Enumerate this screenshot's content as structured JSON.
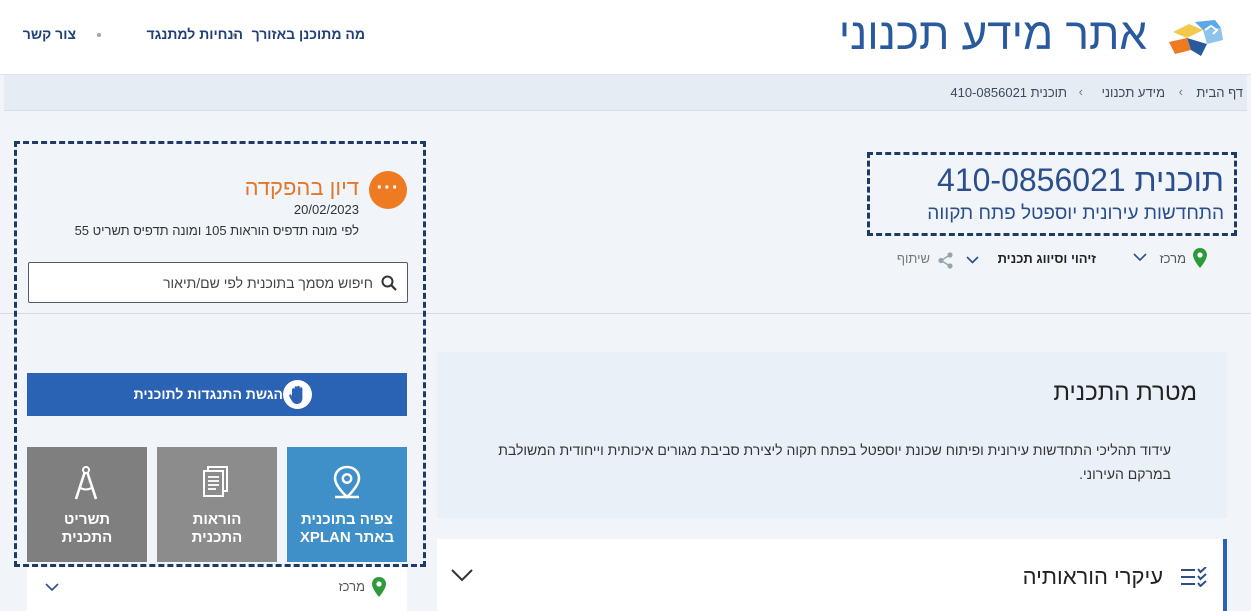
{
  "header": {
    "site_title": "אתר מידע תכנוני",
    "nav": [
      "מה מתוכנן באזורך",
      "הנחיות למתנגד",
      "צור קשר"
    ]
  },
  "breadcrumb": [
    "דף הבית",
    "מידע תכנוני",
    "תוכנית 410-0856021"
  ],
  "plan": {
    "title": "תוכנית 410-0856021",
    "subtitle": "התחדשות עירונית יוספטל פתח תקווה",
    "actions": {
      "center": "מרכז",
      "identification": "זיהוי וסיווג תכנית",
      "share": "שיתוף"
    }
  },
  "status": {
    "title": "דיון בהפקדה",
    "date": "20/02/2023",
    "note": "לפי מונה תדפיס הוראות 105 ומונה תדפיס תשריט 55",
    "circle_icon": "ellipsis-icon"
  },
  "search": {
    "placeholder": "חיפוש מסמך בתוכנית לפי שם/תיאור",
    "value": ""
  },
  "objection_button": "הגשת התנגדות לתוכנית",
  "tiles": [
    {
      "label": "צפיה בתוכנית\nבאתר XPLAN",
      "color": "#3f8fc8",
      "icon": "location-pin-icon"
    },
    {
      "label": "הוראות\nהתכנית",
      "color": "#8c8c8c",
      "icon": "document-icon"
    },
    {
      "label": "תשריט\nהתכנית",
      "color": "#7f7f7f",
      "icon": "compass-icon"
    }
  ],
  "lower_card": {
    "center": "מרכז"
  },
  "goal": {
    "title": "מטרת התכנית",
    "text": "עידוד תהליכי התחדשות עירונית ופיתוח שכונת יוספטל בפתח תקוה ליצירת סביבת מגורים איכותית וייחודית המשולבת במרקם העירוני."
  },
  "provisions": {
    "title": "עיקרי הוראותיה"
  },
  "colors": {
    "primary_blue": "#2a62b4",
    "title_blue": "#2a5a9e",
    "status_orange": "#ee7a22",
    "pin_green": "#2e9b3a"
  }
}
